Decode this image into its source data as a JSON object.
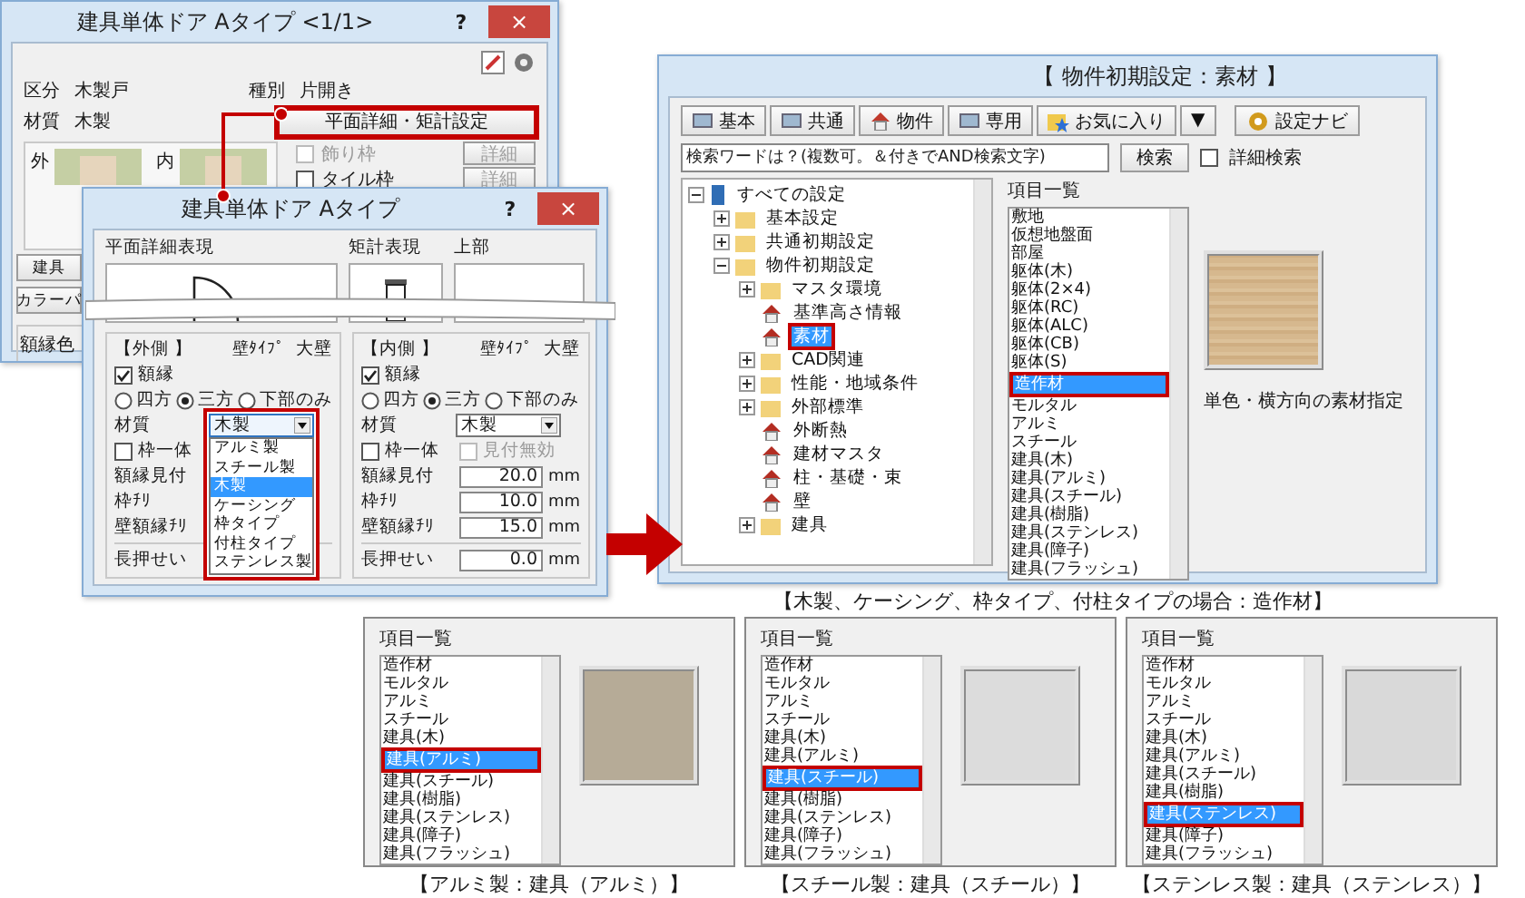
{
  "back_dialog": {
    "title": "建具単体ドア Aタイプ <1/1>",
    "help": "?",
    "close": "×",
    "info": [
      {
        "label": "区分",
        "value": "木製戸"
      },
      {
        "label": "種別",
        "value": "片開き"
      },
      {
        "label": "材質",
        "value": "木製"
      }
    ],
    "settings_button": {
      "label": "平面詳細・矩計設定",
      "highlighted": true
    },
    "previews": [
      {
        "label": "外"
      },
      {
        "label": "内"
      }
    ],
    "options": [
      {
        "label": "飾り枠",
        "checked": false,
        "disabled": true,
        "button": "詳細"
      },
      {
        "label": "タイル枠",
        "checked": false,
        "disabled": false,
        "button": "詳細"
      }
    ],
    "side_buttons": [
      "建具",
      "カラーパ"
    ],
    "frame_color_label": "額縁色"
  },
  "front_dialog": {
    "title": "建具単体ドア Aタイプ",
    "help": "?",
    "close": "×",
    "views": [
      "平面詳細表現",
      "矩計表現",
      "上部"
    ],
    "sides": [
      {
        "heading": "【外側 】",
        "wall_label": "壁ﾀｲﾌﾟ",
        "wall_value": "大壁",
        "frame": {
          "label": "額縁",
          "checked": true
        },
        "radios": [
          {
            "label": "四方",
            "selected": false
          },
          {
            "label": "三方",
            "selected": true
          },
          {
            "label": "下部のみ",
            "selected": false
          }
        ],
        "material": {
          "label": "材質",
          "value": "木製",
          "open": true,
          "options": [
            {
              "label": "アルミ製",
              "selected": false
            },
            {
              "label": "スチール製",
              "selected": false
            },
            {
              "label": "木製",
              "selected": true
            },
            {
              "label": "ケーシング",
              "selected": false
            },
            {
              "label": "枠タイプ",
              "selected": false
            },
            {
              "label": "付柱タイプ",
              "selected": false
            },
            {
              "label": "ステンレス製",
              "selected": false
            }
          ]
        },
        "checks": [
          {
            "label": "枠一体",
            "checked": false,
            "disabled": false
          }
        ],
        "rows": [
          {
            "label": "額縁見付"
          },
          {
            "label": "枠ﾁﾘ"
          },
          {
            "label": "壁額縁ﾁﾘ"
          }
        ],
        "bottom_row": {
          "label": "長押せい"
        }
      },
      {
        "heading": "【内側 】",
        "wall_label": "壁ﾀｲﾌﾟ",
        "wall_value": "大壁",
        "frame": {
          "label": "額縁",
          "checked": true
        },
        "radios": [
          {
            "label": "四方",
            "selected": false
          },
          {
            "label": "三方",
            "selected": true
          },
          {
            "label": "下部のみ",
            "selected": false
          }
        ],
        "material": {
          "label": "材質",
          "value": "木製",
          "open": false
        },
        "checks": [
          {
            "label": "枠一体",
            "checked": false,
            "disabled": false
          },
          {
            "label": "見付無効",
            "checked": false,
            "disabled": true
          }
        ],
        "rows": [
          {
            "label": "額縁見付",
            "value": "20.0",
            "unit": "mm"
          },
          {
            "label": "枠ﾁﾘ",
            "value": "10.0",
            "unit": "mm"
          },
          {
            "label": "壁額縁ﾁﾘ",
            "value": "15.0",
            "unit": "mm"
          }
        ],
        "bottom_row": {
          "label": "長押せい",
          "value": "0.0",
          "unit": "mm"
        }
      }
    ]
  },
  "settings_window": {
    "title": "【 物件初期設定：素材 】",
    "toolbar": [
      {
        "label": "基本",
        "kind": "screen"
      },
      {
        "label": "共通",
        "kind": "screen"
      },
      {
        "label": "物件",
        "kind": "house"
      },
      {
        "label": "専用",
        "kind": "screen"
      },
      {
        "label": "お気に入り",
        "kind": "star"
      },
      {
        "label": "▼",
        "kind": "menu"
      },
      {
        "label": "設定ナビ",
        "kind": "gear"
      }
    ],
    "search": {
      "placeholder": "検索ワードは？(複数可。＆付きでAND検索文字)",
      "button": "検索",
      "detail": {
        "label": "詳細検索",
        "checked": false
      }
    },
    "tree": [
      {
        "label": "すべての設定",
        "kind": "root",
        "expanded": true,
        "selected": false,
        "children": [
          {
            "label": "基本設定",
            "kind": "folder",
            "expanded": false,
            "selected": false
          },
          {
            "label": "共通初期設定",
            "kind": "folder",
            "expanded": false,
            "selected": false
          },
          {
            "label": "物件初期設定",
            "kind": "folder",
            "expanded": true,
            "selected": false,
            "children": [
              {
                "label": "マスタ環境",
                "kind": "folder",
                "expanded": false,
                "selected": false
              },
              {
                "label": "基準高さ情報",
                "kind": "item",
                "selected": false
              },
              {
                "label": "素材",
                "kind": "item",
                "selected": true
              },
              {
                "label": "CAD関連",
                "kind": "folder",
                "expanded": false,
                "selected": false
              },
              {
                "label": "性能・地域条件",
                "kind": "folder",
                "expanded": false,
                "selected": false
              },
              {
                "label": "外部標準",
                "kind": "folder",
                "expanded": false,
                "selected": false
              },
              {
                "label": "外断熱",
                "kind": "item",
                "selected": false
              },
              {
                "label": "建材マスタ",
                "kind": "item",
                "selected": false
              },
              {
                "label": "柱・基礎・束",
                "kind": "item",
                "selected": false
              },
              {
                "label": "壁",
                "kind": "item",
                "selected": false
              },
              {
                "label": "建具",
                "kind": "folder",
                "expanded": false,
                "selected": false
              }
            ]
          }
        ]
      }
    ],
    "list": {
      "heading": "項目一覧",
      "items": [
        {
          "label": "敷地",
          "selected": false
        },
        {
          "label": "仮想地盤面",
          "selected": false
        },
        {
          "label": "部屋",
          "selected": false
        },
        {
          "label": "躯体(木)",
          "selected": false
        },
        {
          "label": "躯体(2×4)",
          "selected": false
        },
        {
          "label": "躯体(RC)",
          "selected": false
        },
        {
          "label": "躯体(ALC)",
          "selected": false
        },
        {
          "label": "躯体(CB)",
          "selected": false
        },
        {
          "label": "躯体(S)",
          "selected": false
        },
        {
          "label": "造作材",
          "selected": true
        },
        {
          "label": "モルタル",
          "selected": false
        },
        {
          "label": "アルミ",
          "selected": false
        },
        {
          "label": "スチール",
          "selected": false
        },
        {
          "label": "建具(木)",
          "selected": false
        },
        {
          "label": "建具(アルミ)",
          "selected": false
        },
        {
          "label": "建具(スチール)",
          "selected": false
        },
        {
          "label": "建具(樹脂)",
          "selected": false
        },
        {
          "label": "建具(ステンレス)",
          "selected": false
        },
        {
          "label": "建具(障子)",
          "selected": false
        },
        {
          "label": "建具(フラッシュ)",
          "selected": false
        }
      ]
    },
    "preview_caption": "単色・横方向の素材指定",
    "caption": "【木製、ケーシング、枠タイプ、付柱タイプの場合：造作材】"
  },
  "examples": [
    {
      "heading": "項目一覧",
      "color": "#b6ab97",
      "caption": "【アルミ製：建具（アルミ）】",
      "items": [
        {
          "label": "造作材",
          "selected": false
        },
        {
          "label": "モルタル",
          "selected": false
        },
        {
          "label": "アルミ",
          "selected": false
        },
        {
          "label": "スチール",
          "selected": false
        },
        {
          "label": "建具(木)",
          "selected": false
        },
        {
          "label": "建具(アルミ)",
          "selected": true
        },
        {
          "label": "建具(スチール)",
          "selected": false
        },
        {
          "label": "建具(樹脂)",
          "selected": false
        },
        {
          "label": "建具(ステンレス)",
          "selected": false
        },
        {
          "label": "建具(障子)",
          "selected": false
        },
        {
          "label": "建具(フラッシュ)",
          "selected": false
        }
      ]
    },
    {
      "heading": "項目一覧",
      "color": "#dcdcdc",
      "caption": "【スチール製：建具（スチール）】",
      "items": [
        {
          "label": "造作材",
          "selected": false
        },
        {
          "label": "モルタル",
          "selected": false
        },
        {
          "label": "アルミ",
          "selected": false
        },
        {
          "label": "スチール",
          "selected": false
        },
        {
          "label": "建具(木)",
          "selected": false
        },
        {
          "label": "建具(アルミ)",
          "selected": false
        },
        {
          "label": "建具(スチール)",
          "selected": true
        },
        {
          "label": "建具(樹脂)",
          "selected": false
        },
        {
          "label": "建具(ステンレス)",
          "selected": false
        },
        {
          "label": "建具(障子)",
          "selected": false
        },
        {
          "label": "建具(フラッシュ)",
          "selected": false
        }
      ]
    },
    {
      "heading": "項目一覧",
      "color": "#d9d9d9",
      "caption": "【ステンレス製：建具（ステンレス）】",
      "items": [
        {
          "label": "造作材",
          "selected": false
        },
        {
          "label": "モルタル",
          "selected": false
        },
        {
          "label": "アルミ",
          "selected": false
        },
        {
          "label": "スチール",
          "selected": false
        },
        {
          "label": "建具(木)",
          "selected": false
        },
        {
          "label": "建具(アルミ)",
          "selected": false
        },
        {
          "label": "建具(スチール)",
          "selected": false
        },
        {
          "label": "建具(樹脂)",
          "selected": false
        },
        {
          "label": "建具(ステンレス)",
          "selected": true
        },
        {
          "label": "建具(障子)",
          "selected": false
        },
        {
          "label": "建具(フラッシュ)",
          "selected": false
        }
      ]
    }
  ]
}
